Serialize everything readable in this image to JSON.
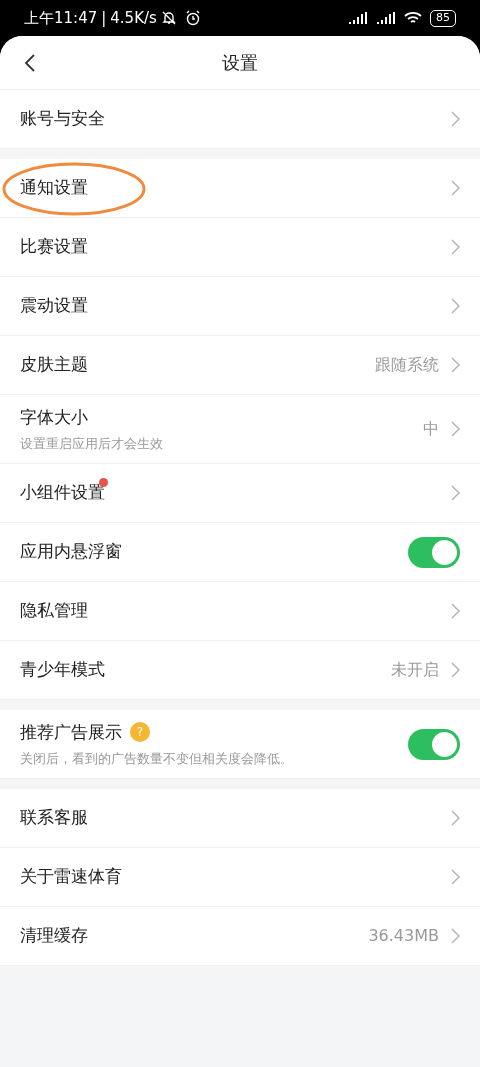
{
  "status_bar": {
    "time": "上午11:47",
    "separator": "|",
    "speed": "4.5K/s",
    "battery": "85"
  },
  "header": {
    "title": "设置"
  },
  "groups": [
    {
      "items": [
        {
          "kind": "link",
          "label": "账号与安全",
          "circled": false,
          "dot": false
        }
      ]
    },
    {
      "items": [
        {
          "kind": "link",
          "label": "通知设置",
          "circled": true,
          "dot": false
        },
        {
          "kind": "link",
          "label": "比赛设置",
          "circled": false,
          "dot": false
        },
        {
          "kind": "link",
          "label": "震动设置",
          "circled": false,
          "dot": false
        },
        {
          "kind": "link",
          "label": "皮肤主题",
          "value": "跟随系统",
          "circled": false,
          "dot": false
        },
        {
          "kind": "link",
          "label": "字体大小",
          "sublabel": "设置重启应用后才会生效",
          "value": "中",
          "circled": false,
          "dot": false
        },
        {
          "kind": "link",
          "label": "小组件设置",
          "circled": false,
          "dot": true
        },
        {
          "kind": "toggle",
          "label": "应用内悬浮窗",
          "on": true,
          "circled": false,
          "dot": false
        },
        {
          "kind": "link",
          "label": "隐私管理",
          "circled": false,
          "dot": false
        },
        {
          "kind": "link",
          "label": "青少年模式",
          "value": "未开启",
          "circled": false,
          "dot": false
        }
      ]
    },
    {
      "items": [
        {
          "kind": "toggle",
          "label": "推荐广告展示",
          "help": "?",
          "sublabel": "关闭后，看到的广告数量不变但相关度会降低。",
          "on": true,
          "circled": false,
          "dot": false
        }
      ]
    },
    {
      "items": [
        {
          "kind": "link",
          "label": "联系客服",
          "circled": false,
          "dot": false
        },
        {
          "kind": "link",
          "label": "关于雷速体育",
          "circled": false,
          "dot": false
        },
        {
          "kind": "link",
          "label": "清理缓存",
          "value": "36.43MB",
          "circled": false,
          "dot": false
        }
      ]
    }
  ]
}
